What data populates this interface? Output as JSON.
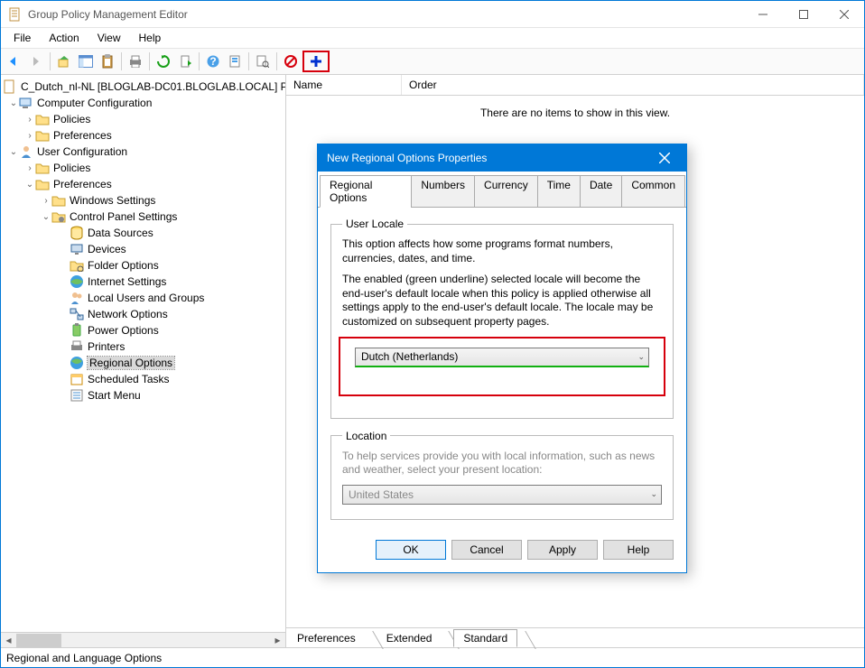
{
  "window": {
    "title": "Group Policy Management Editor"
  },
  "menu": {
    "file": "File",
    "action": "Action",
    "view": "View",
    "help": "Help"
  },
  "tree": {
    "root": "C_Dutch_nl-NL [BLOGLAB-DC01.BLOGLAB.LOCAL] P",
    "computer_cfg": "Computer Configuration",
    "cc_policies": "Policies",
    "cc_prefs": "Preferences",
    "user_cfg": "User Configuration",
    "uc_policies": "Policies",
    "uc_prefs": "Preferences",
    "win_settings": "Windows Settings",
    "cp_settings": "Control Panel Settings",
    "items": {
      "data_sources": "Data Sources",
      "devices": "Devices",
      "folder_options": "Folder Options",
      "internet_settings": "Internet Settings",
      "local_users": "Local Users and Groups",
      "network_options": "Network Options",
      "power_options": "Power Options",
      "printers": "Printers",
      "regional_options": "Regional Options",
      "scheduled_tasks": "Scheduled Tasks",
      "start_menu": "Start Menu"
    }
  },
  "list": {
    "col_name": "Name",
    "col_order": "Order",
    "empty": "There are no items to show in this view."
  },
  "bottom_tabs": {
    "preferences": "Preferences",
    "extended": "Extended",
    "standard": "Standard"
  },
  "status": "Regional and Language Options",
  "dialog": {
    "title": "New Regional Options Properties",
    "tabs": {
      "regional": "Regional Options",
      "numbers": "Numbers",
      "currency": "Currency",
      "time": "Time",
      "date": "Date",
      "common": "Common"
    },
    "group_locale": "User Locale",
    "locale_desc1": "This option affects how some programs format numbers, currencies, dates, and time.",
    "locale_desc2": "The enabled (green underline) selected locale will become the end-user's default locale when this policy is applied otherwise all settings apply to the end-user's default locale. The locale may be customized on subsequent property pages.",
    "locale_value": "Dutch (Netherlands)",
    "group_location": "Location",
    "location_desc": "To help services provide you with local information, such as news and weather, select your present location:",
    "location_value": "United States",
    "buttons": {
      "ok": "OK",
      "cancel": "Cancel",
      "apply": "Apply",
      "help": "Help"
    }
  }
}
